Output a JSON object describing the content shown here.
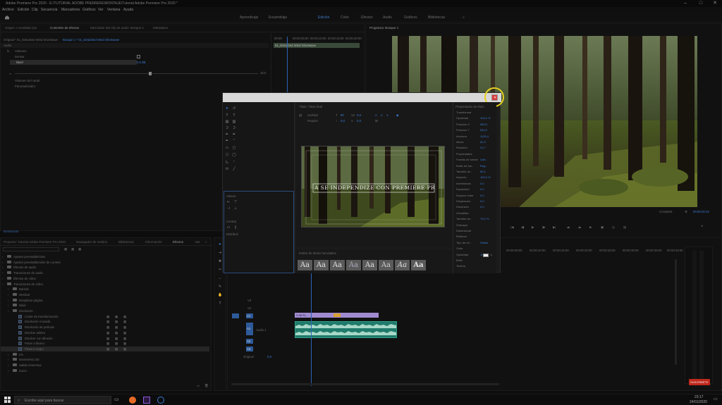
{
  "app": {
    "title": "Adobe Premiere Pro 2020 - E:\\TUTORIAL ADOBE PREMIERE\\MONTAJE\\Tutorial Adobe Premiere Pro 2020 *",
    "window_controls": [
      "–",
      "□",
      "✕"
    ]
  },
  "menu": [
    "Archivo",
    "Edición",
    "Clip",
    "Secuencia",
    "Marcadores",
    "Gráficos",
    "Ver",
    "Ventana",
    "Ayuda"
  ],
  "workspaces": {
    "items": [
      "Aprendizaje",
      "Ensamblaje",
      "Edición",
      "Color",
      "Efectos",
      "Audio",
      "Gráficos",
      "Bibliotecas",
      "»"
    ],
    "active": "Edición"
  },
  "source_panel": {
    "tabs": [
      "Origen: A modalità (sin",
      "Controles de efectos",
      "Mezclador del clip de audio: Bosque 1",
      "Metadatos"
    ],
    "subheader": "Original * 01_Disturbed Wind Shortwave",
    "clip_label": "Bosque 1 * 01_Disturbed Wind Shortwave",
    "section_audio": "Audio",
    "fx_volume": "Volumen",
    "fx_bypass": "Derivar",
    "fx_level": "Nivel",
    "fx_level_value": "0,0 dB",
    "slider_max": "15,0",
    "fx_channel_volume": "Volumen del canal",
    "fx_panner": "Panoramizador",
    "timeline_clip": "01_Disturbed Wind Shortwave",
    "ruler": [
      "00:00",
      "00:00:05:00",
      "00:00:10:00",
      "00:00:15:00",
      "00:00:20:00"
    ],
    "timecode_footer": "00:00:00:00"
  },
  "program_panel": {
    "tab": "Programa: Bosque 1",
    "fit_label": "Completa",
    "timecode": "00:00:20:13"
  },
  "effects_panel": {
    "tabs": [
      "Proyecto: Tutorial Adobe Premiere Pro 2020",
      "Navegador de medios",
      "Bibliotecas",
      "Información",
      "Efectos",
      "Ma",
      "»"
    ],
    "active_tab": "Efectos",
    "tree": [
      {
        "label": "Ajustes preestablecidos",
        "level": 0,
        "kind": "folder"
      },
      {
        "label": "Ajustes preestablecidos de Lumetri",
        "level": 0,
        "kind": "folder"
      },
      {
        "label": "Efectos de audio",
        "level": 0,
        "kind": "folder"
      },
      {
        "label": "Transiciones de audio",
        "level": 0,
        "kind": "folder"
      },
      {
        "label": "Efectos de vídeo",
        "level": 0,
        "kind": "folder"
      },
      {
        "label": "Transiciones de vídeo",
        "level": 0,
        "kind": "folder"
      },
      {
        "label": "Barrido",
        "level": 1,
        "kind": "folder"
      },
      {
        "label": "Deslizar",
        "level": 1,
        "kind": "folder"
      },
      {
        "label": "Desplazar página",
        "level": 1,
        "kind": "folder"
      },
      {
        "label": "Diluir",
        "level": 1,
        "kind": "folder"
      },
      {
        "label": "Disolución",
        "level": 1,
        "kind": "folder"
      },
      {
        "label": "Cortar de transformación",
        "level": 2,
        "kind": "fx"
      },
      {
        "label": "Disolución cruzada",
        "level": 2,
        "kind": "fx"
      },
      {
        "label": "Disolución de película",
        "level": 2,
        "kind": "fx"
      },
      {
        "label": "Disolver aditivo",
        "level": 2,
        "kind": "fx"
      },
      {
        "label": "Disolver con difusión",
        "level": 2,
        "kind": "fx"
      },
      {
        "label": "Pasar a blanco",
        "level": 2,
        "kind": "fx"
      },
      {
        "label": "Pasar a negro",
        "level": 2,
        "kind": "fx"
      },
      {
        "label": "Iris",
        "level": 1,
        "kind": "folder"
      },
      {
        "label": "Movimiento 3D",
        "level": 1,
        "kind": "folder"
      },
      {
        "label": "Salida inmersiva",
        "level": 1,
        "kind": "folder"
      },
      {
        "label": "Zoom",
        "level": 1,
        "kind": "folder"
      }
    ],
    "selected": "Pasar a negro"
  },
  "timeline": {
    "ruler": [
      "00:00:05:00",
      "00:00:10:00",
      "00:00:15:00",
      "00:00:20:00",
      "00:00:25:00",
      "00:00:30:00",
      "00:00:35:00",
      "00:00:40:00"
    ],
    "tracks": [
      "V3",
      "V2",
      "V1",
      "A1",
      "A2",
      "A3",
      "Original"
    ],
    "audio_clip_label": "Audio 1",
    "original_value": "0,0",
    "title_clip_label": "A se lo..."
  },
  "dialog": {
    "title_tab": "Título: Título final",
    "font": "Unifraid",
    "style": "Regular",
    "font_size": "80",
    "kerning": "0,0",
    "leading": "0,0",
    "tracking": "0,0",
    "title_text": "A SE INDEPENDIZE CON PREMIERE PRO",
    "tools_label_align": "Alinear",
    "tools_label_center": "Centrar",
    "tools_label_distribute": "Distribuir",
    "styles_tab": "Estilos de títulos heredados",
    "style_swatches": [
      "Aa",
      "Aa",
      "Aa",
      "Aa",
      "Aa",
      "Aa",
      "Aa",
      "Aa"
    ],
    "props_tab": "Propiedades de título",
    "props": [
      {
        "name": "Transformar",
        "value": ""
      },
      {
        "name": "Opacidad",
        "value": "100,0 %"
      },
      {
        "name": "Posición X",
        "value": "960,0"
      },
      {
        "name": "Posición Y",
        "value": "540,0"
      },
      {
        "name": "Anchura",
        "value": "1125,4"
      },
      {
        "name": "Altura",
        "value": "81,3"
      },
      {
        "name": "Rotación",
        "value": "0,0 °"
      },
      {
        "name": "Propiedades",
        "value": ""
      },
      {
        "name": "Familia de fuente",
        "value": "Unif..."
      },
      {
        "name": "Estilo de fue...",
        "value": "Reg..."
      },
      {
        "name": "Tamaño de...",
        "value": "80,0"
      },
      {
        "name": "Aspecto",
        "value": "100,0 %"
      },
      {
        "name": "Interlineado",
        "value": "0,0"
      },
      {
        "name": "Espaciado",
        "value": "0,0"
      },
      {
        "name": "Espacio entre",
        "value": "0,0"
      },
      {
        "name": "Desplazam.",
        "value": "0,0"
      },
      {
        "name": "Distorsión",
        "value": "0,0"
      },
      {
        "name": "Versalitas",
        "value": ""
      },
      {
        "name": "Tamaño de...",
        "value": "75,0 %"
      },
      {
        "name": "Subrayar",
        "value": ""
      },
      {
        "name": "Distorsionar",
        "value": ""
      },
      {
        "name": "Rellenar",
        "value": ""
      },
      {
        "name": "Tipo de rel...",
        "value": "Sólido"
      },
      {
        "name": "Color",
        "value": ""
      },
      {
        "name": "Opacidad",
        "value": "100 %"
      },
      {
        "name": "Brillo",
        "value": ""
      },
      {
        "name": "Textura",
        "value": ""
      }
    ]
  },
  "taskbar": {
    "search_placeholder": "Escribe aquí para buscar",
    "time": "23:17",
    "date": "24/01/2020"
  },
  "overlay": {
    "subscribe_label": "SUSCRIBETE"
  }
}
